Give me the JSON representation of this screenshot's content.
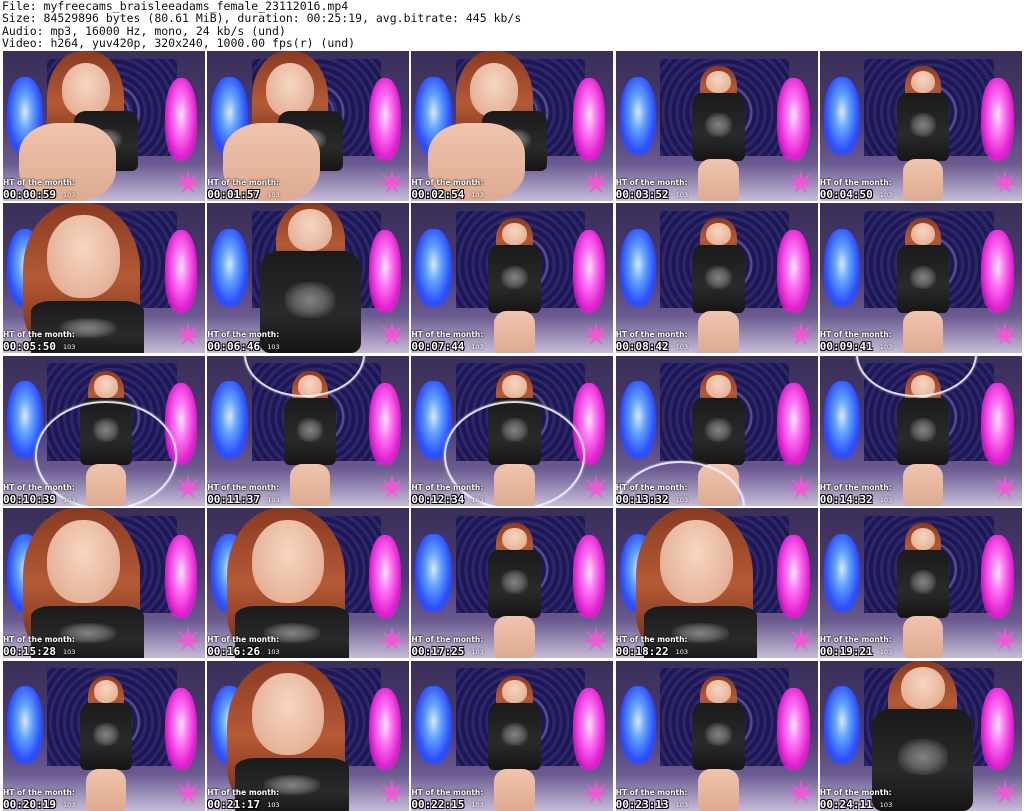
{
  "header": {
    "file_line": "File: myfreecams_braisleeadams_female_23112016.mp4",
    "size_line": "Size: 84529896 bytes (80.61 MiB), duration: 00:25:19, avg.bitrate: 445 kb/s",
    "audio_line": "Audio: mp3, 16000 Hz, mono, 24 kb/s (und)",
    "video_line": "Video: h264, yuv420p, 320x240, 1000.00 fps(r) (und)"
  },
  "overlay": {
    "label": "HT of the month:",
    "number": "103"
  },
  "colors": {
    "lamp_blue": "#2b4dff",
    "lamp_pink": "#e020d0",
    "leaf": "#ff4fd8"
  },
  "thumbnails": [
    {
      "time": "00:00:59",
      "scene": "closeup-sitting"
    },
    {
      "time": "00:01:57",
      "scene": "sitting-chair"
    },
    {
      "time": "00:02:54",
      "scene": "sitting-chair"
    },
    {
      "time": "00:03:52",
      "scene": "standing"
    },
    {
      "time": "00:04:50",
      "scene": "standing-side"
    },
    {
      "time": "00:05:50",
      "scene": "closeup-face"
    },
    {
      "time": "00:06:46",
      "scene": "standing-close"
    },
    {
      "time": "00:07:44",
      "scene": "standing"
    },
    {
      "time": "00:08:42",
      "scene": "standing-back"
    },
    {
      "time": "00:09:41",
      "scene": "standing"
    },
    {
      "time": "00:10:39",
      "scene": "hoop"
    },
    {
      "time": "00:11:37",
      "scene": "hoop-top"
    },
    {
      "time": "00:12:34",
      "scene": "hoop"
    },
    {
      "time": "00:13:32",
      "scene": "hoop-low"
    },
    {
      "time": "00:14:32",
      "scene": "hoop-top"
    },
    {
      "time": "00:15:28",
      "scene": "closeup-face"
    },
    {
      "time": "00:16:26",
      "scene": "closeup-face"
    },
    {
      "time": "00:17:25",
      "scene": "standing"
    },
    {
      "time": "00:18:22",
      "scene": "closeup-face"
    },
    {
      "time": "00:19:21",
      "scene": "standing"
    },
    {
      "time": "00:20:19",
      "scene": "standing"
    },
    {
      "time": "00:21:17",
      "scene": "closeup-face"
    },
    {
      "time": "00:22:15",
      "scene": "standing"
    },
    {
      "time": "00:23:13",
      "scene": "standing"
    },
    {
      "time": "00:24:11",
      "scene": "standing-close"
    }
  ]
}
